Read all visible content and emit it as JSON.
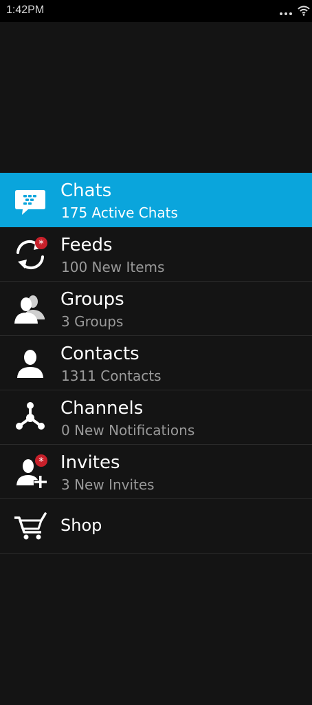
{
  "status_bar": {
    "time": "1:42PM",
    "icons": [
      "more-dots-icon",
      "wifi-icon"
    ]
  },
  "menu": {
    "items": [
      {
        "icon": "chat-bubble-icon",
        "title": "Chats",
        "subtitle": "175 Active Chats",
        "selected": true
      },
      {
        "icon": "feeds-sync-icon",
        "title": "Feeds",
        "subtitle": "100 New Items",
        "badge": true
      },
      {
        "icon": "groups-icon",
        "title": "Groups",
        "subtitle": "3 Groups"
      },
      {
        "icon": "contact-icon",
        "title": "Contacts",
        "subtitle": "1311 Contacts"
      },
      {
        "icon": "channels-icon",
        "title": "Channels",
        "subtitle": "0 New Notifications"
      },
      {
        "icon": "invite-contact-icon",
        "title": "Invites",
        "subtitle": "3 New Invites",
        "badge": true
      },
      {
        "icon": "shopping-cart-icon",
        "title": "Shop"
      }
    ]
  },
  "colors": {
    "background": "#141414",
    "status_bar": "#000000",
    "selected": "#0aa5dc",
    "badge": "#c8202a",
    "subtitle": "#9a9a9a"
  }
}
